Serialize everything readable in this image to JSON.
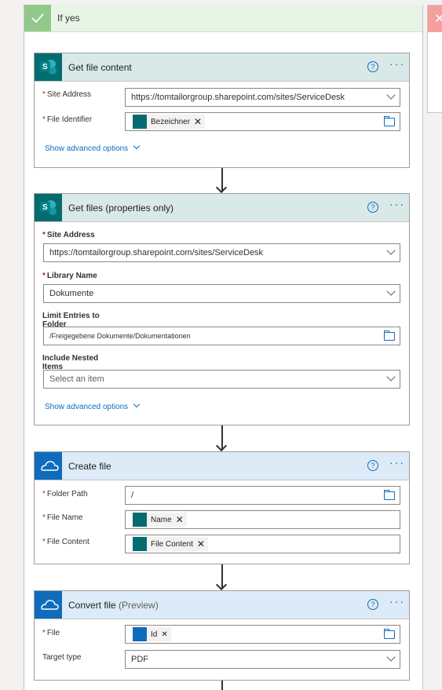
{
  "branch": {
    "title": "If yes"
  },
  "actions": {
    "get_file_content": {
      "title": "Get file content",
      "site_label": "Site Address",
      "site_value": "https://tomtailorgroup.sharepoint.com/sites/ServiceDesk",
      "file_id_label": "File Identifier",
      "file_id_token": "Bezeichner",
      "advanced": "Show advanced options"
    },
    "get_files": {
      "title": "Get files (properties only)",
      "site_label": "Site Address",
      "site_value": "https://tomtailorgroup.sharepoint.com/sites/ServiceDesk",
      "library_label": "Library Name",
      "library_value": "Dokumente",
      "limit_label_1": "Limit Entries to",
      "limit_label_2": "Folder",
      "limit_value": "/Freigegebene Dokumente/Dokumentationen",
      "nested_label_1": "Include Nested",
      "nested_label_2": "Items",
      "nested_placeholder": "Select an item",
      "advanced": "Show advanced options"
    },
    "create_file": {
      "title": "Create file",
      "folder_label": "Folder Path",
      "folder_value": "/",
      "name_label": "File Name",
      "name_token": "Name",
      "content_label": "File Content",
      "content_token": "File Content"
    },
    "convert_file": {
      "title": "Convert file",
      "title_suffix": "(Preview)",
      "file_label": "File",
      "file_token": "Id",
      "target_label": "Target type",
      "target_value": "PDF"
    }
  },
  "common": {
    "help": "?",
    "more": "···",
    "remove": "✕",
    "required": "*"
  },
  "icons": {
    "sharepoint": "sharepoint-icon",
    "onedrive": "onedrive-icon",
    "check": "check-icon",
    "folder": "folder-icon",
    "chevron": "chevron-down-icon",
    "close": "close-icon"
  },
  "colors": {
    "sharepoint": "#036c70",
    "onedrive": "#0f6cbd",
    "link": "#0f6cbd",
    "yes_branch": "#92c98b",
    "no_branch": "#f4a09c"
  }
}
